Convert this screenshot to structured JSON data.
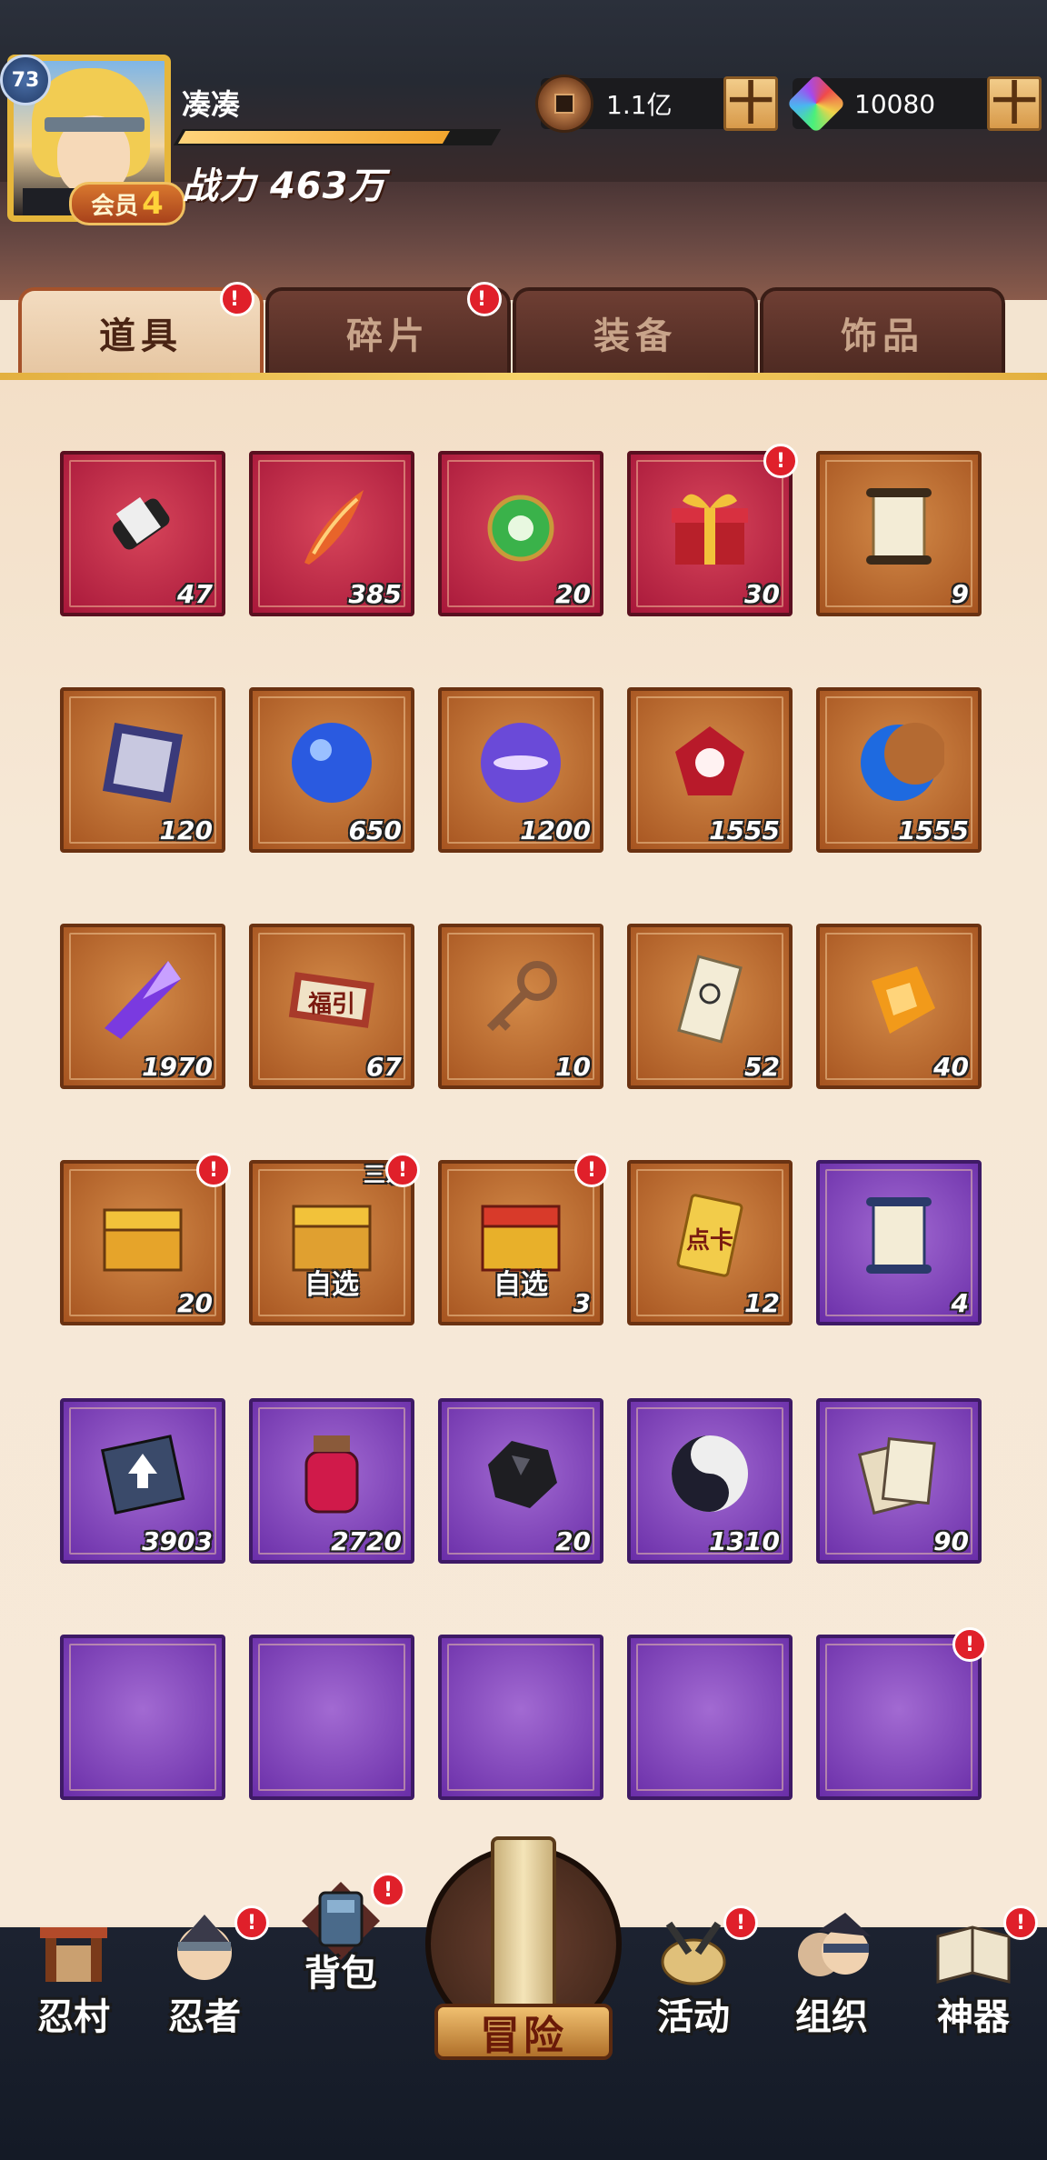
{
  "player": {
    "level": "73",
    "name": "凑凑",
    "vip_label": "会员",
    "vip_level": "4",
    "power_label": "战力",
    "power_value": "463万",
    "exp_fraction": 0.83
  },
  "currencies": [
    {
      "icon": "copper-coin-icon",
      "value": "1.1亿",
      "add_label": "十"
    },
    {
      "icon": "rainbow-gem-icon",
      "value": "10080",
      "add_label": "十"
    }
  ],
  "tabs": [
    {
      "label": "道具",
      "active": true,
      "badge": "!"
    },
    {
      "label": "碎片",
      "active": false,
      "badge": "!"
    },
    {
      "label": "装备",
      "active": false,
      "badge": ""
    },
    {
      "label": "饰品",
      "active": false,
      "badge": ""
    }
  ],
  "items": [
    {
      "icon": "black-scroll-icon",
      "rarity": "red",
      "count": "47"
    },
    {
      "icon": "fire-feather-icon",
      "rarity": "red",
      "count": "385"
    },
    {
      "icon": "green-jade-pendant-icon",
      "rarity": "red",
      "count": "20"
    },
    {
      "icon": "gift-box-icon",
      "rarity": "red",
      "count": "30",
      "badge": "!"
    },
    {
      "icon": "paper-scroll-icon",
      "rarity": "orange",
      "count": "9"
    },
    {
      "icon": "seal-cloth-icon",
      "rarity": "orange",
      "count": "120"
    },
    {
      "icon": "blue-orb-icon",
      "rarity": "orange",
      "count": "650"
    },
    {
      "icon": "purple-orb-icon",
      "rarity": "orange",
      "count": "1200"
    },
    {
      "icon": "red-gem-icon",
      "rarity": "orange",
      "count": "1555"
    },
    {
      "icon": "blue-crescent-icon",
      "rarity": "orange",
      "count": "1555"
    },
    {
      "icon": "purple-crystal-icon",
      "rarity": "orange",
      "count": "1970"
    },
    {
      "icon": "fortune-ticket-icon",
      "rarity": "orange",
      "count": "67",
      "text": "福引"
    },
    {
      "icon": "bronze-key-icon",
      "rarity": "orange",
      "count": "10"
    },
    {
      "icon": "spiral-talisman-icon",
      "rarity": "orange",
      "count": "52"
    },
    {
      "icon": "amber-stone-icon",
      "rarity": "orange",
      "count": "40"
    },
    {
      "icon": "golden-chest-icon",
      "rarity": "orange",
      "count": "20",
      "badge": "!"
    },
    {
      "icon": "select-chest-icon",
      "rarity": "orange",
      "count": "",
      "sub": "自选",
      "corner": "三系",
      "badge": "!"
    },
    {
      "icon": "select-treasure-chest-icon",
      "rarity": "orange",
      "count": "3",
      "sub": "自选",
      "badge": "!"
    },
    {
      "icon": "point-card-icon",
      "rarity": "orange",
      "count": "12",
      "text": "点卡"
    },
    {
      "icon": "blue-scroll-icon",
      "rarity": "purple",
      "count": "4"
    },
    {
      "icon": "upgrade-book-icon",
      "rarity": "purple",
      "count": "3903"
    },
    {
      "icon": "red-potion-jar-icon",
      "rarity": "purple",
      "count": "2720"
    },
    {
      "icon": "black-ore-icon",
      "rarity": "purple",
      "count": "20"
    },
    {
      "icon": "yin-yang-icon",
      "rarity": "purple",
      "count": "1310"
    },
    {
      "icon": "cards-stack-icon",
      "rarity": "purple",
      "count": "90"
    },
    {
      "icon": "",
      "rarity": "purple",
      "count": ""
    },
    {
      "icon": "",
      "rarity": "purple",
      "count": ""
    },
    {
      "icon": "",
      "rarity": "purple",
      "count": ""
    },
    {
      "icon": "",
      "rarity": "purple",
      "count": ""
    },
    {
      "icon": "",
      "rarity": "purple",
      "count": "",
      "badge": "!"
    }
  ],
  "nav": [
    {
      "label": "忍村",
      "icon": "village-gate-icon",
      "badge": ""
    },
    {
      "label": "忍者",
      "icon": "ninja-head-icon",
      "badge": "!"
    },
    {
      "label": "背包",
      "icon": "backpack-icon",
      "badge": "!"
    },
    {
      "label": "冒险",
      "icon": "adventure-scroll-icon",
      "badge": ""
    },
    {
      "label": "活动",
      "icon": "kunai-drum-icon",
      "badge": "!"
    },
    {
      "label": "组织",
      "icon": "organization-icon",
      "badge": ""
    },
    {
      "label": "神器",
      "icon": "artifact-book-icon",
      "badge": "!"
    }
  ],
  "colors": {
    "rarity_red": "#c22a48",
    "rarity_orange": "#c07034",
    "rarity_purple": "#8a4ac0",
    "badge_red": "#e0202a",
    "tab_line_gold": "#f6d36a"
  }
}
